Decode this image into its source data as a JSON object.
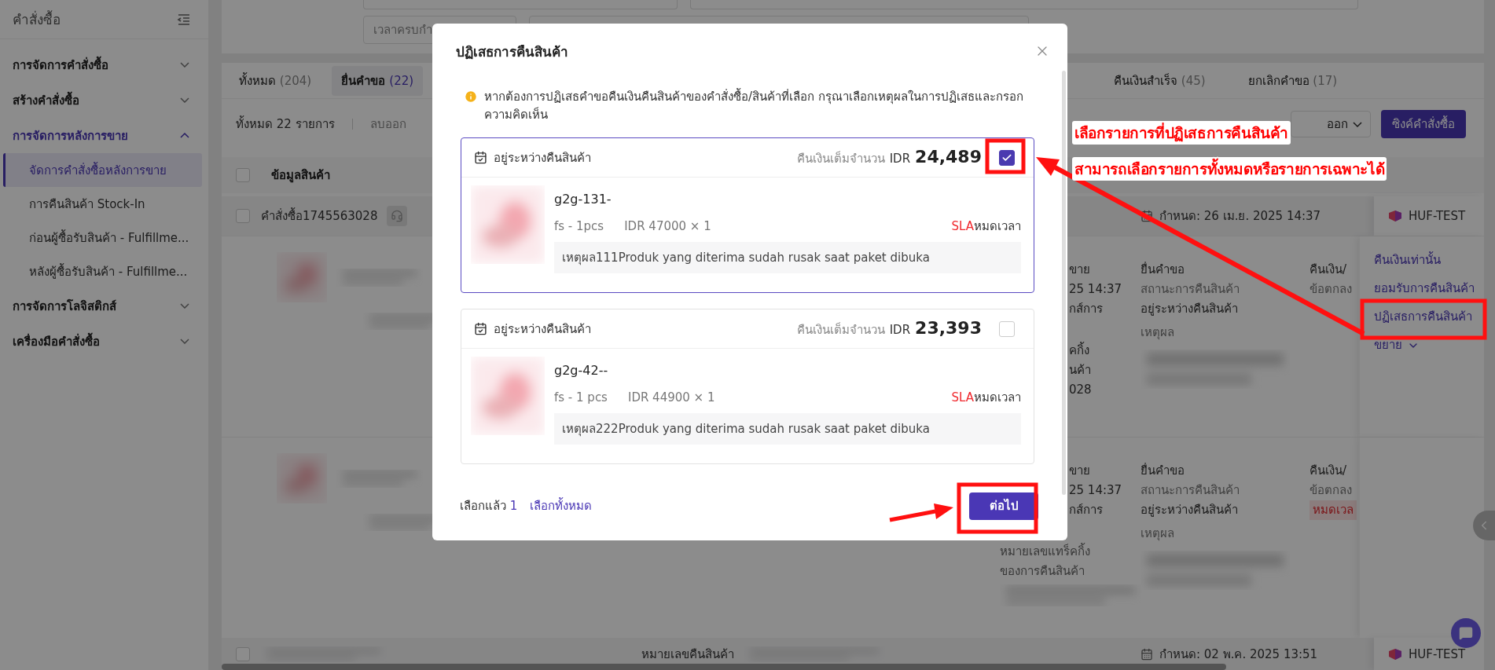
{
  "sidebar": {
    "title": "คำสั่งซื้อ",
    "items": [
      {
        "label": "การจัดการคำสั่งซื้อ",
        "expanded": false
      },
      {
        "label": "สร้างคำสั่งซื้อ",
        "expanded": false
      },
      {
        "label": "การจัดการหลังการขาย",
        "expanded": true,
        "children": [
          {
            "label": "จัดการคำสั่งซื้อหลังการขาย",
            "selected": true
          },
          {
            "label": "การคืนสินค้า Stock-In",
            "selected": false
          },
          {
            "label": "ก่อนผู้ซื้อรับสินค้า - Fulfillme...",
            "selected": false
          },
          {
            "label": "หลังผู้ซื้อรับสินค้า - Fulfillme...",
            "selected": false
          }
        ]
      },
      {
        "label": "การจัดการโลจิสติกส์",
        "expanded": false
      },
      {
        "label": "เครื่องมือคำสั่งซื้อ",
        "expanded": false
      }
    ]
  },
  "filters": {
    "placeholder": "เวลาครบกำ"
  },
  "tabs": [
    {
      "label": "ทั้งหมด",
      "count": "(204)",
      "selected": false
    },
    {
      "label": "ยื่นคำขอ",
      "count": "(22)",
      "selected": true
    },
    {
      "label": "คืนเงินสำเร็จ",
      "count": "(45)",
      "selected": false
    },
    {
      "label": "ยกเลิกคำขอ",
      "count": "(17)",
      "selected": false
    }
  ],
  "toolbar": {
    "total": "ทั้งหมด 22 รายการ",
    "remove": "ลบออก",
    "export": "ออก",
    "sync": "ซิงค์คำสั่งซื้อ"
  },
  "table": {
    "columns": [
      "ข้อมูลสินค้า"
    ],
    "all_checked": false,
    "orders": [
      {
        "order_no": "คำสั่งซื้อ1745563028",
        "checked": false,
        "deadline": "กำหนด:  26 เม.ย. 2025 14:37",
        "shop": "HUF-TEST",
        "items": [
          {
            "column_2": [
              {
                "kind": "fragment",
                "lines": [
                  "ขาย",
                  "25 14:37",
                  "กส์การ"
                ]
              },
              {
                "kind": "fragment",
                "lines": [
                  "คกิ้ง",
                  "นค้า",
                  "028"
                ]
              }
            ],
            "request": "ยื่นคำขอ",
            "status_label": "สถานะการคืนสินค้า",
            "status": "อยู่ระหว่างคืนสินค้า",
            "reason_label": "เหตุผล",
            "refund": "คืนเงิน/",
            "agreement": "ข้อตกลง",
            "actions": [
              "คืนเงินเท่านั้น",
              "ยอมรับการคืนสินค้า",
              "ปฏิเสธการคืนสินค้า"
            ],
            "expand": "ขยาย"
          },
          {
            "column_2": [
              {
                "kind": "fragment",
                "lines": [
                  "ขาย",
                  "25 14:37",
                  "กส์การ"
                ]
              },
              {
                "kind": "full",
                "lines": [
                  "หมายเลขแทร็คกิ้ง",
                  "ของการคืนสินค้า"
                ]
              }
            ],
            "request": "ยื่นคำขอ",
            "status_label": "สถานะการคืนสินค้า",
            "status": "อยู่ระหว่างคืนสินค้า",
            "reason_label": "เหตุผล",
            "refund": "คืนเงิน/",
            "agreement": "ข้อตกลง",
            "badge": "หมดเวล"
          }
        ]
      },
      {
        "return_label": "หมายเลขคืนสินค้า",
        "checked": false,
        "deadline": "กำหนด:  02 พ.ค. 2025 13:51",
        "shop": "HUF-TEST"
      }
    ]
  },
  "modal": {
    "title": "ปฏิเสธการคืนสินค้า",
    "notice": "หากต้องการปฏิเสธคำขอคืนเงินคืนสินค้าของคำสั่งซื้อ/สินค้าที่เลือก กรุณาเลือกเหตุผลในการปฏิเสธและกรอกความคิดเห็น",
    "items": [
      {
        "status": "อยู่ระหว่างคืนสินค้า",
        "refund_label": "คืนเงินเต็มจำนวน",
        "currency": "IDR",
        "amount": "24,489",
        "checked": true,
        "name": "g2g-131-",
        "variant": "fs - 1pcs",
        "price": "IDR 47000 × 1",
        "sla": "SLA",
        "sla_status": "หมดเวลา",
        "reason": "เหตุผล111Produk yang diterima sudah rusak saat paket dibuka"
      },
      {
        "status": "อยู่ระหว่างคืนสินค้า",
        "refund_label": "คืนเงินเต็มจำนวน",
        "currency": "IDR",
        "amount": "23,393",
        "checked": false,
        "name": "g2g-42--",
        "variant": "fs - 1 pcs",
        "price": "IDR 44900 × 1",
        "sla": "SLA",
        "sla_status": "หมดเวลา",
        "reason": "เหตุผล222Produk yang diterima sudah rusak saat paket dibuka"
      }
    ],
    "footer": {
      "selected_label": "เลือกแล้ว",
      "selected_count": "1",
      "select_all": "เลือกทั้งหมด",
      "next": "ต่อไป"
    }
  },
  "annotations": [
    "เลือกรายการที่ปฏิเสธการคืนสินค้า",
    "สามารถเลือกรายการทั้งหมดหรือรายการเฉพาะได้"
  ]
}
